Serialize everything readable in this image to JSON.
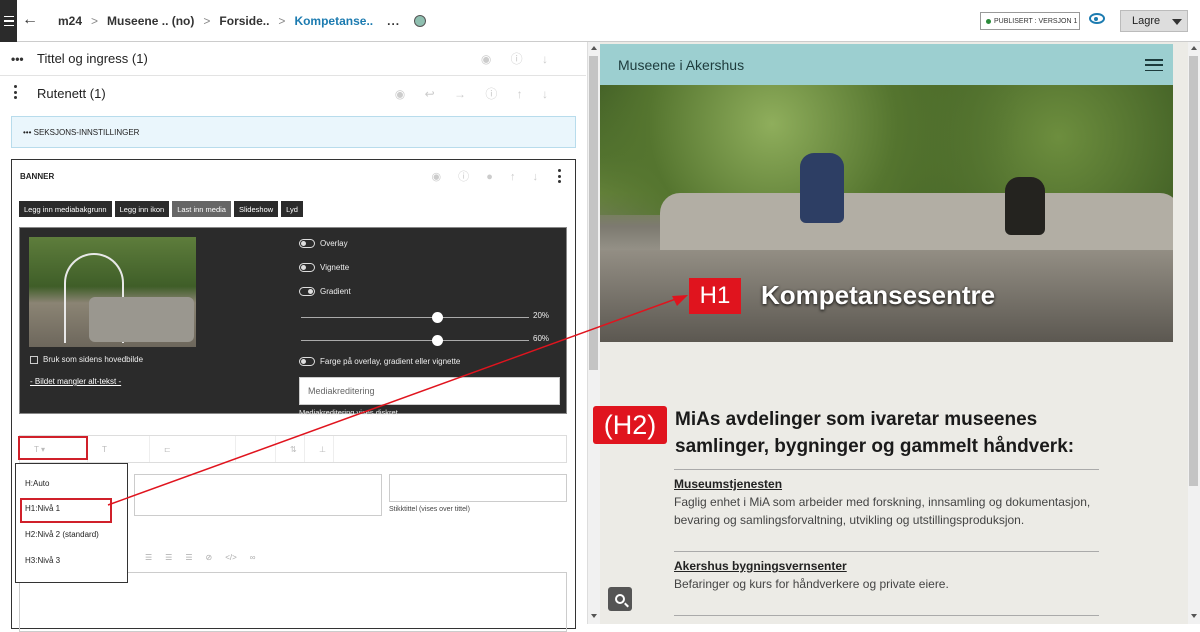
{
  "breadcrumb": [
    "m24",
    "Museene .. (no)",
    "Forside..",
    "Kompetanse.."
  ],
  "more_label": "...",
  "publish_badge": "PUBLISERT : VERSJON 1",
  "save_label": "Lagre",
  "editor": {
    "rows": [
      "Tittel og ingress (1)",
      "Rutenett (1)"
    ],
    "section_settings": "SEKSJONS-INNSTILLINGER",
    "banner_title": "BANNER",
    "media_buttons": [
      "Legg inn mediabakgrunn",
      "Legg inn ikon",
      "Last inn media",
      "Slideshow",
      "Lyd"
    ],
    "toggles": [
      "Overlay",
      "Vignette",
      "Gradient"
    ],
    "slider_values": [
      "20%",
      "60%"
    ],
    "color_toggle": "Farge på overlay, gradient eller vignette",
    "use_main_image": "Bruk som sidens hovedbilde",
    "alt_missing": "- Bildet mangler alt-tekst -",
    "media_credit_placeholder": "Mediakreditering",
    "media_credit_note": "Mediakreditering vises diskret",
    "heading_options": [
      "H:Auto",
      "H1:Nivå 1",
      "H2:Nivå 2 (standard)",
      "H3:Nivå 3"
    ],
    "stikk_label": "Stikktittel (vises over tittel)"
  },
  "preview": {
    "site_name": "Museene i Akershus",
    "h1_tag": "H1",
    "h1_text": "Kompetansesentre",
    "h2_tag": "(H2)",
    "h2_text": "MiAs avdelinger som ivaretar museenes samlinger, bygninger og gammelt håndverk:",
    "items": [
      {
        "title": "Museumstjenesten",
        "desc": "Faglig enhet i MiA som arbeider med forskning, innsamling og dokumentasjon, bevaring og samlingsforvaltning, utvikling og utstillingsproduksjon."
      },
      {
        "title": "Akershus bygningsvernsenter",
        "desc": "Befaringer og kurs for håndverkere og private eiere."
      }
    ]
  },
  "colors": {
    "accent": "#1c7bb0",
    "highlight": "#e0141e",
    "header_bg": "#9ccfd0"
  }
}
